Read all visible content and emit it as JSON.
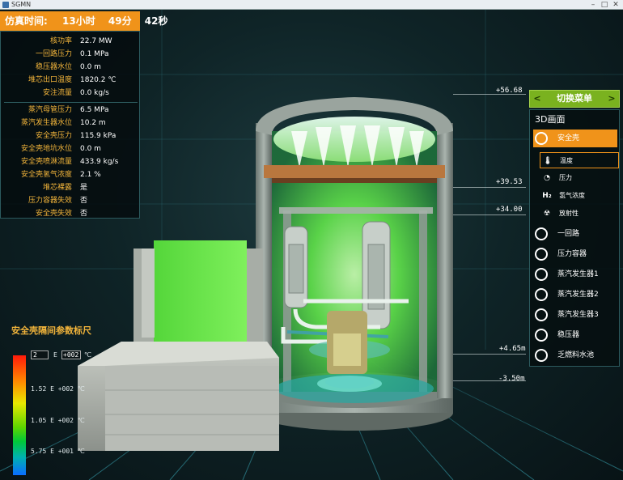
{
  "window": {
    "title": "SGMN",
    "minimize": "–",
    "maximize": "□",
    "close": "✕"
  },
  "sim_time": {
    "label": "仿真时间:",
    "hours": "13小时",
    "minutes": "49分",
    "seconds": "42秒"
  },
  "params": [
    {
      "label": "核功率",
      "value": "22.7 MW"
    },
    {
      "label": "一回路压力",
      "value": "0.1 MPa"
    },
    {
      "label": "稳压器水位",
      "value": "0.0  m"
    },
    {
      "label": "堆芯出口温度",
      "value": "1820.2 ℃"
    },
    {
      "label": "安注流量",
      "value": "0.0  kg/s"
    },
    {
      "label": "蒸汽母管压力",
      "value": "6.5  MPa"
    },
    {
      "label": "蒸汽发生器水位",
      "value": "10.2  m"
    },
    {
      "label": "安全壳压力",
      "value": "115.9  kPa"
    },
    {
      "label": "安全壳地坑水位",
      "value": "0.0  m"
    },
    {
      "label": "安全壳喷淋流量",
      "value": "433.9  kg/s"
    },
    {
      "label": "安全壳氢气浓度",
      "value": "2.1  %"
    },
    {
      "label": "堆芯裸露",
      "value": "是"
    },
    {
      "label": "压力容器失效",
      "value": "否"
    },
    {
      "label": "安全壳失效",
      "value": "否"
    }
  ],
  "menu": {
    "header": "切换菜单",
    "prev_arrow": "<",
    "next_arrow": ">",
    "title": "3D画面",
    "containment": "安全壳",
    "sub_items": [
      {
        "label": "温度",
        "icon": "thermometer-icon",
        "glyph": "🌡"
      },
      {
        "label": "压力",
        "icon": "gauge-icon",
        "glyph": "◔"
      },
      {
        "label": "氢气浓度",
        "icon": "hydrogen-icon",
        "glyph": "H₂"
      },
      {
        "label": "放射性",
        "icon": "radiation-icon",
        "glyph": "☢"
      }
    ],
    "items": [
      {
        "label": "一回路",
        "icon": "primary-loop-icon"
      },
      {
        "label": "压力容器",
        "icon": "pressure-vessel-icon"
      },
      {
        "label": "蒸汽发生器1",
        "icon": "steam-generator-icon"
      },
      {
        "label": "蒸汽发生器2",
        "icon": "steam-generator-icon"
      },
      {
        "label": "蒸汽发生器3",
        "icon": "steam-generator-icon"
      },
      {
        "label": "稳压器",
        "icon": "pressurizer-icon"
      },
      {
        "label": "乏燃料水池",
        "icon": "spent-fuel-pool-icon"
      }
    ]
  },
  "elevations": [
    "+56.68",
    "+39.53",
    "+34.00",
    "+4.65m",
    "-3.50m"
  ],
  "legend": {
    "title": "安全壳隔间参数标尺",
    "top_value": "2",
    "top_e": "E",
    "top_exp": "+002",
    "unit": "℃",
    "ticks": [
      "1.52  E  +002 ℃",
      "1.05  E  +002 ℃",
      "5.75  E  +001 ℃"
    ],
    "colors": [
      "#ff1a0a",
      "#ff8a00",
      "#e8e800",
      "#5ed600",
      "#00c93a",
      "#00b2b0",
      "#0a6cff"
    ]
  },
  "colors": {
    "accent_orange": "#f0931a",
    "label_gold": "#f3b53b",
    "menu_green": "#7ab21f"
  }
}
